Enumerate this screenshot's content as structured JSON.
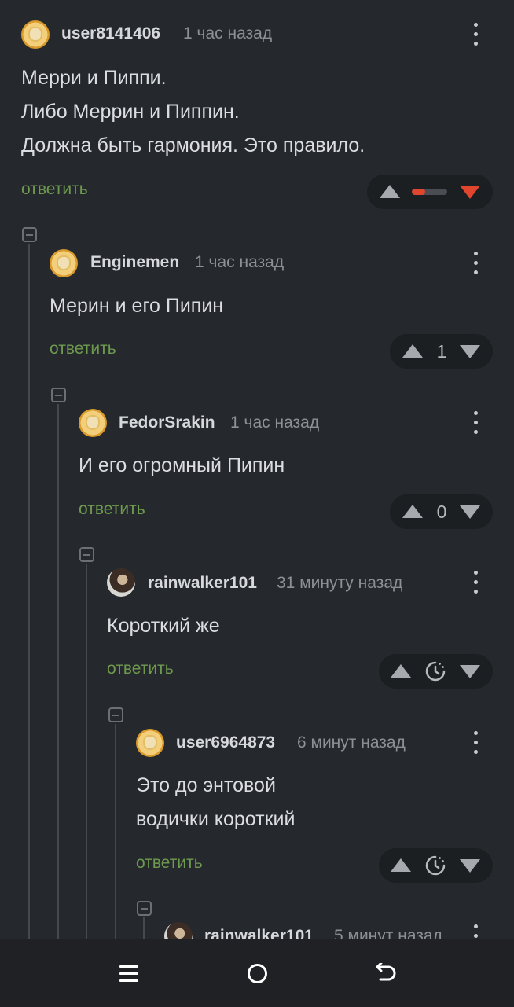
{
  "comments": [
    {
      "username": "user8141406",
      "time": "1 час назад",
      "lines": [
        "Мерри и Пиппи.",
        "Либо Меррин и Пиппин.",
        "Должна быть гармония. Это правило."
      ],
      "reply_label": "ответить",
      "rating_state": "negative",
      "avatar": "coin-avatar"
    },
    {
      "username": "Enginemen",
      "time": "1 час назад",
      "lines": [
        "Мерин и его Пипин"
      ],
      "reply_label": "ответить",
      "score": "1",
      "avatar": "coin-avatar"
    },
    {
      "username": "FedorSrakin",
      "time": "1 час назад",
      "lines": [
        "И его огромный Пипин"
      ],
      "reply_label": "ответить",
      "score": "0",
      "avatar": "coin-avatar"
    },
    {
      "username": "rainwalker101",
      "time": "31 минуту назад",
      "lines": [
        "Короткий же"
      ],
      "reply_label": "ответить",
      "score_icon": "clock-icon",
      "avatar": "photo-avatar"
    },
    {
      "username": "user6964873",
      "time": "6 минут назад",
      "lines": [
        "Это до энтовой",
        "водички короткий"
      ],
      "reply_label": "ответить",
      "score_icon": "clock-icon",
      "avatar": "coin-avatar"
    },
    {
      "username": "rainwalker101",
      "time": "5 минут назад",
      "avatar": "photo-avatar"
    }
  ],
  "colors": {
    "background": "#25282c",
    "reply_green": "#6e9a4f",
    "downvote_red": "#e0452e",
    "vote_bg": "#1c1f22"
  },
  "navbar": {
    "icons": [
      "recent-apps-icon",
      "home-icon",
      "back-icon"
    ]
  }
}
